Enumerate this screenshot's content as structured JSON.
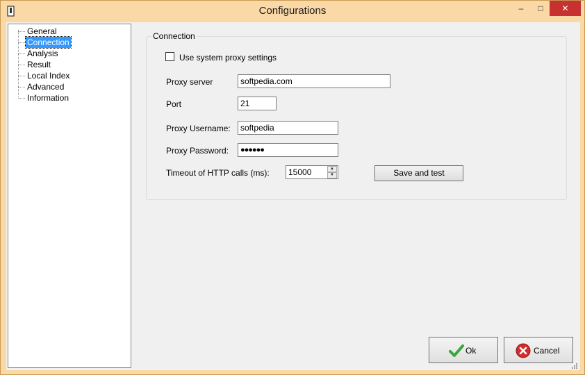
{
  "window": {
    "title": "Configurations",
    "minimize_glyph": "–",
    "maximize_glyph": "□",
    "close_glyph": "✕"
  },
  "tree": {
    "items": [
      {
        "label": "General",
        "selected": false
      },
      {
        "label": "Connection",
        "selected": true
      },
      {
        "label": "Analysis",
        "selected": false
      },
      {
        "label": "Result",
        "selected": false
      },
      {
        "label": "Local Index",
        "selected": false
      },
      {
        "label": "Advanced",
        "selected": false
      },
      {
        "label": "Information",
        "selected": false
      }
    ]
  },
  "connection": {
    "legend": "Connection",
    "use_system_proxy_label": "Use system proxy settings",
    "use_system_proxy_checked": false,
    "proxy_server_label": "Proxy server",
    "proxy_server_value": "softpedia.com",
    "port_label": "Port",
    "port_value": "21",
    "proxy_username_label": "Proxy Username:",
    "proxy_username_value": "softpedia",
    "proxy_password_label": "Proxy Password:",
    "proxy_password_value": "●●●●●●",
    "timeout_label": "Timeout of HTTP calls (ms):",
    "timeout_value": "15000",
    "save_test_label": "Save and test"
  },
  "footer": {
    "ok_label": "Ok",
    "cancel_label": "Cancel",
    "ok_icon": "checkmark-icon",
    "cancel_icon": "cancel-icon"
  },
  "colors": {
    "titlebar": "#fbd9a6",
    "close_button": "#c7312f",
    "selection": "#3399ff",
    "ok_green": "#3aa53a",
    "cancel_red": "#d42b2b"
  }
}
